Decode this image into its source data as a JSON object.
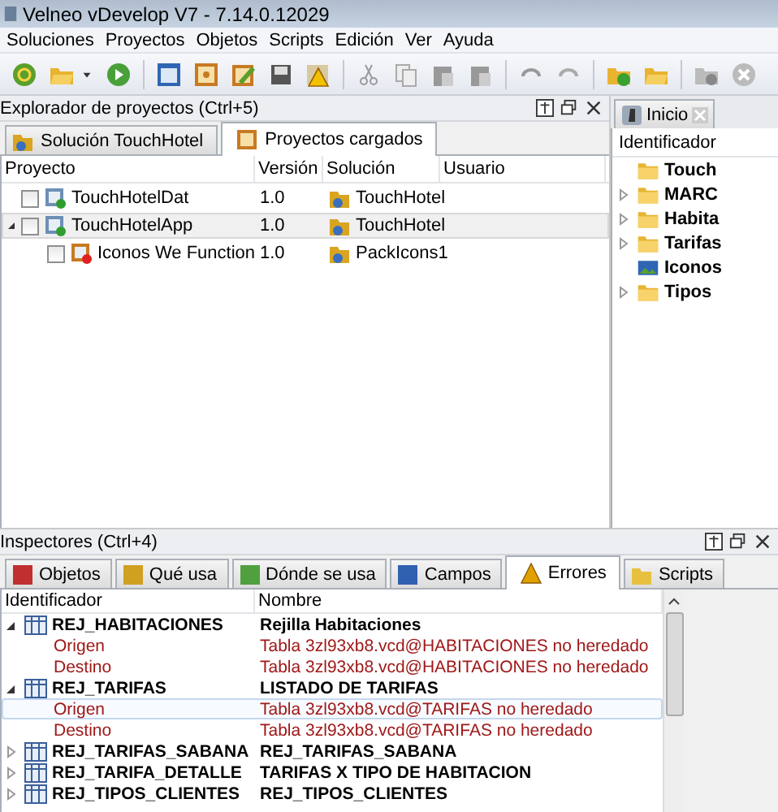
{
  "window": {
    "title": "Velneo vDevelop V7 - 7.14.0.12029"
  },
  "menu": [
    "Soluciones",
    "Proyectos",
    "Objetos",
    "Scripts",
    "Edición",
    "Ver",
    "Ayuda"
  ],
  "explorer": {
    "title": "Explorador de proyectos (Ctrl+5)",
    "tabs": [
      {
        "label": "Solución TouchHotel",
        "selected": false,
        "kind": "solution"
      },
      {
        "label": "Proyectos cargados",
        "selected": true,
        "kind": "project"
      }
    ],
    "columns": [
      "Proyecto",
      "Versión",
      "Solución",
      "Usuario"
    ],
    "rows": [
      {
        "name": "TouchHotelDat",
        "version": "1.0",
        "solution": "TouchHotel",
        "checked": false,
        "selected": false,
        "kind": "ok"
      },
      {
        "name": "TouchHotelApp",
        "version": "1.0",
        "solution": "TouchHotel",
        "checked": false,
        "selected": true,
        "kind": "ok",
        "expanded": true,
        "children": [
          {
            "name": "Iconos We Function",
            "version": "1.0",
            "solution": "PackIcons1",
            "checked": false,
            "selected": false,
            "kind": "error"
          }
        ]
      }
    ]
  },
  "side": {
    "tab": "Inicio",
    "column": "Identificador",
    "items": [
      {
        "label": "Touch",
        "kind": "folder",
        "expandable": false
      },
      {
        "label": "MARC",
        "kind": "folder",
        "expandable": true
      },
      {
        "label": "Habita",
        "kind": "folder",
        "expandable": true
      },
      {
        "label": "Tarifas",
        "kind": "folder",
        "expandable": true
      },
      {
        "label": "Iconos",
        "kind": "image",
        "expandable": false
      },
      {
        "label": "Tipos",
        "kind": "folder",
        "expandable": true
      }
    ]
  },
  "inspectors": {
    "title": "Inspectores (Ctrl+4)",
    "tabs": [
      {
        "label": "Objetos",
        "selected": false,
        "kind": "objects"
      },
      {
        "label": "Qué usa",
        "selected": false,
        "kind": "uses"
      },
      {
        "label": "Dónde se usa",
        "selected": false,
        "kind": "where"
      },
      {
        "label": "Campos",
        "selected": false,
        "kind": "fields"
      },
      {
        "label": "Errores",
        "selected": true,
        "kind": "errors"
      },
      {
        "label": "Scripts",
        "selected": false,
        "kind": "scripts"
      }
    ],
    "columns": [
      "Identificador",
      "Nombre"
    ],
    "rows": [
      {
        "id": "REJ_HABITACIONES",
        "name": "Rejilla Habitaciones",
        "expanded": true,
        "children": [
          {
            "id": "Origen",
            "name": "Tabla 3zl93xb8.vcd@HABITACIONES no heredado",
            "selected": false
          },
          {
            "id": "Destino",
            "name": "Tabla 3zl93xb8.vcd@HABITACIONES no heredado",
            "selected": false
          }
        ]
      },
      {
        "id": "REJ_TARIFAS",
        "name": "LISTADO DE TARIFAS",
        "expanded": true,
        "children": [
          {
            "id": "Origen",
            "name": "Tabla 3zl93xb8.vcd@TARIFAS no heredado",
            "selected": true
          },
          {
            "id": "Destino",
            "name": "Tabla 3zl93xb8.vcd@TARIFAS no heredado",
            "selected": false
          }
        ]
      },
      {
        "id": "REJ_TARIFAS_SABANA",
        "name": "REJ_TARIFAS_SABANA",
        "expanded": false
      },
      {
        "id": "REJ_TARIFA_DETALLE",
        "name": "TARIFAS X TIPO DE HABITACION",
        "expanded": false
      },
      {
        "id": "REJ_TIPOS_CLIENTES",
        "name": "REJ_TIPOS_CLIENTES",
        "expanded": false
      }
    ]
  }
}
